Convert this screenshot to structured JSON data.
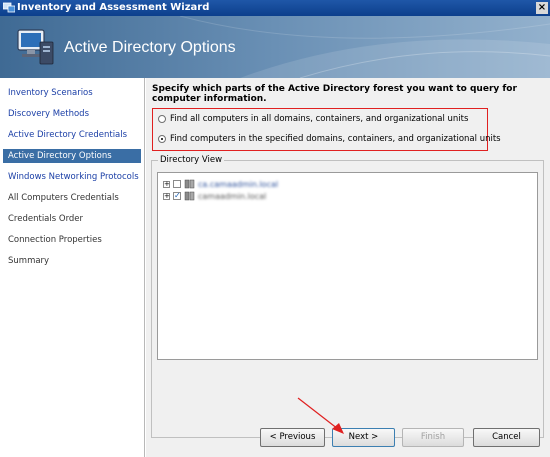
{
  "window": {
    "title": "Inventory and Assessment Wizard",
    "close_glyph": "×"
  },
  "banner": {
    "title": "Active Directory Options",
    "icon": "directory-computer-icon"
  },
  "nav": {
    "items": [
      {
        "label": "Inventory Scenarios",
        "state": "link"
      },
      {
        "label": "Discovery Methods",
        "state": "link"
      },
      {
        "label": "Active Directory Credentials",
        "state": "link"
      },
      {
        "label": "Active Directory Options",
        "state": "selected"
      },
      {
        "label": "Windows Networking Protocols",
        "state": "link"
      },
      {
        "label": "All Computers Credentials",
        "state": "plain"
      },
      {
        "label": "Credentials Order",
        "state": "plain"
      },
      {
        "label": "Connection Properties",
        "state": "plain"
      },
      {
        "label": "Summary",
        "state": "plain"
      }
    ]
  },
  "content": {
    "question": "Specify which parts of the Active Directory forest you want to query for computer information.",
    "options": [
      {
        "label": "Find all computers in all domains, containers, and organizational units",
        "selected": false
      },
      {
        "label": "Find computers in the specified domains, containers, and organizational units",
        "selected": true
      }
    ],
    "directory_view": {
      "legend": "Directory View",
      "nodes": [
        {
          "label": "ca.camaadmin.local",
          "checked": false
        },
        {
          "label": "camaadmin.local",
          "checked": true
        }
      ]
    }
  },
  "buttons": {
    "previous": "< Previous",
    "next": "Next >",
    "finish": "Finish",
    "cancel": "Cancel"
  },
  "colors": {
    "selection": "#3a6ea5",
    "highlight_box": "#e02020",
    "link": "#1a3ea6"
  }
}
